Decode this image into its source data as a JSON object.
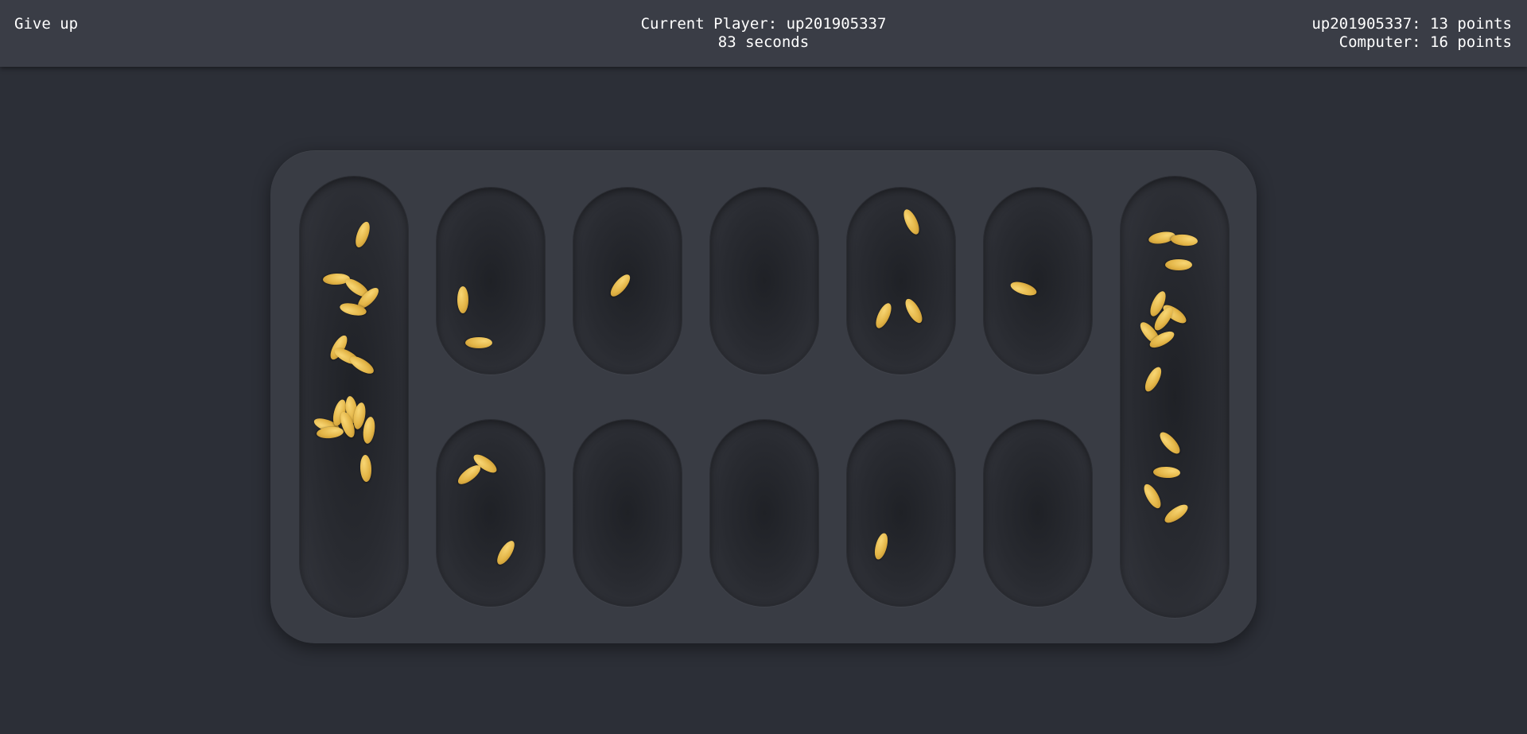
{
  "header": {
    "give_up_label": "Give up",
    "current_player": "Current Player: up201905337",
    "timer": "83 seconds",
    "player_score": "up201905337: 13 points",
    "computer_score": "Computer: 16 points"
  },
  "board": {
    "seed_color": "#e3b547",
    "background": "#393c44",
    "pits": {
      "left_store": 16,
      "top_row": [
        2,
        1,
        0,
        3,
        1
      ],
      "bottom_row": [
        3,
        0,
        0,
        1,
        0
      ],
      "right_store": 13
    }
  }
}
